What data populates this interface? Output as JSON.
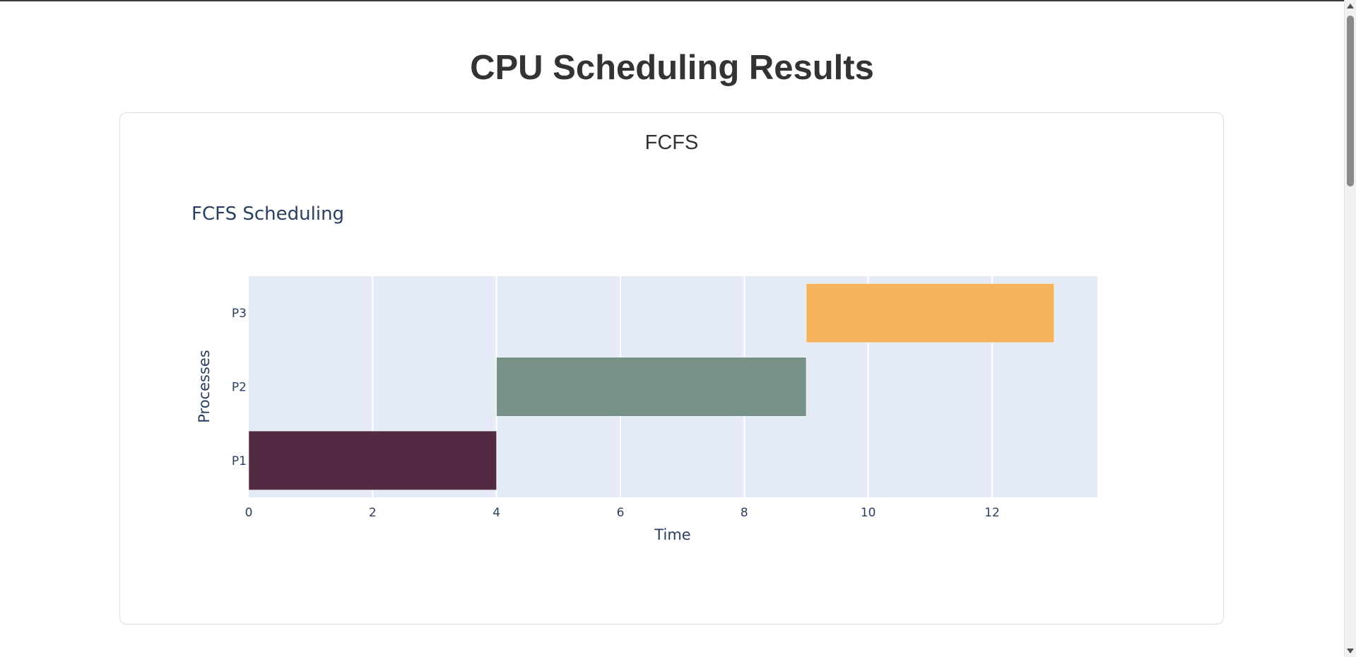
{
  "page": {
    "title": "CPU Scheduling Results"
  },
  "section": {
    "heading": "FCFS"
  },
  "chart_data": {
    "type": "bar",
    "orientation": "horizontal-gantt",
    "title": "FCFS Scheduling",
    "xlabel": "Time",
    "ylabel": "Processes",
    "xlim": [
      0,
      13.7
    ],
    "xticks": [
      0,
      2,
      4,
      6,
      8,
      10,
      12
    ],
    "categories": [
      "P1",
      "P2",
      "P3"
    ],
    "bars": [
      {
        "process": "P1",
        "start": 0,
        "end": 4,
        "color": "#522a43"
      },
      {
        "process": "P2",
        "start": 4,
        "end": 9,
        "color": "#789186"
      },
      {
        "process": "P3",
        "start": 9,
        "end": 13,
        "color": "#f5b35e"
      }
    ],
    "grid": true,
    "plot_bg": "#e5ebf6",
    "text_color": "#2a3f5f"
  }
}
